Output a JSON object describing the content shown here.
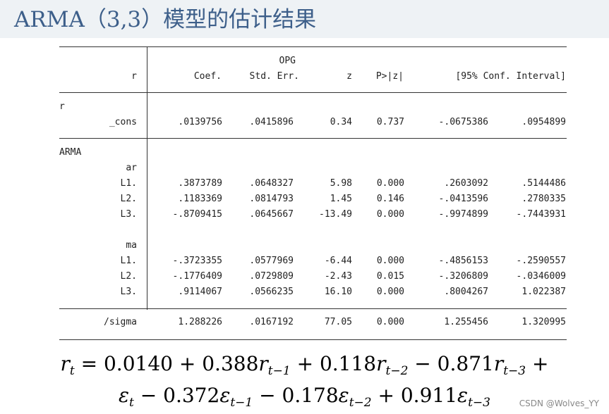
{
  "title": "ARMA（3,3）模型的估计结果",
  "header": {
    "depvar": "r",
    "opg": "OPG",
    "coef": "Coef.",
    "stderr": "Std. Err.",
    "z": "z",
    "p": "P>|z|",
    "ci": "[95% Conf. Interval]"
  },
  "groups": [
    {
      "name": "r",
      "subs": [
        {
          "name": "",
          "rows": [
            {
              "label": "_cons",
              "values": [
                ".0139756",
                ".0415896",
                "0.34",
                "0.737",
                "-.0675386",
                ".0954899"
              ]
            }
          ]
        }
      ]
    },
    {
      "name": "ARMA",
      "subs": [
        {
          "name": "ar",
          "rows": [
            {
              "label": "L1.",
              "values": [
                ".3873789",
                ".0648327",
                "5.98",
                "0.000",
                ".2603092",
                ".5144486"
              ]
            },
            {
              "label": "L2.",
              "values": [
                ".1183369",
                ".0814793",
                "1.45",
                "0.146",
                "-.0413596",
                ".2780335"
              ]
            },
            {
              "label": "L3.",
              "values": [
                "-.8709415",
                ".0645667",
                "-13.49",
                "0.000",
                "-.9974899",
                "-.7443931"
              ]
            }
          ]
        },
        {
          "name": "ma",
          "rows": [
            {
              "label": "L1.",
              "values": [
                "-.3723355",
                ".0577969",
                "-6.44",
                "0.000",
                "-.4856153",
                "-.2590557"
              ]
            },
            {
              "label": "L2.",
              "values": [
                "-.1776409",
                ".0729809",
                "-2.43",
                "0.015",
                "-.3206809",
                "-.0346009"
              ]
            },
            {
              "label": "L3.",
              "values": [
                ".9114067",
                ".0566235",
                "16.10",
                "0.000",
                ".8004267",
                "1.022387"
              ]
            }
          ]
        }
      ]
    },
    {
      "name": "",
      "subs": [
        {
          "name": "",
          "rows": [
            {
              "label": "/sigma",
              "values": [
                "1.288226",
                ".0167192",
                "77.05",
                "0.000",
                "1.255456",
                "1.320995"
              ]
            }
          ]
        }
      ]
    }
  ],
  "equation": {
    "line1": [
      {
        "v": "r",
        "s": "t"
      },
      {
        "t": " = 0.0140 + 0.388"
      },
      {
        "v": "r",
        "s": "t−1"
      },
      {
        "t": " + 0.118"
      },
      {
        "v": "r",
        "s": "t−2"
      },
      {
        "t": " − 0.871"
      },
      {
        "v": "r",
        "s": "t−3"
      },
      {
        "t": " +"
      }
    ],
    "line2": [
      {
        "v": "ε",
        "s": "t"
      },
      {
        "t": " − 0.372"
      },
      {
        "v": "ε",
        "s": "t−1"
      },
      {
        "t": " − 0.178"
      },
      {
        "v": "ε",
        "s": "t−2"
      },
      {
        "t": " + 0.911"
      },
      {
        "v": "ε",
        "s": "t−3"
      }
    ]
  },
  "watermark": "CSDN @Wolves_YY"
}
